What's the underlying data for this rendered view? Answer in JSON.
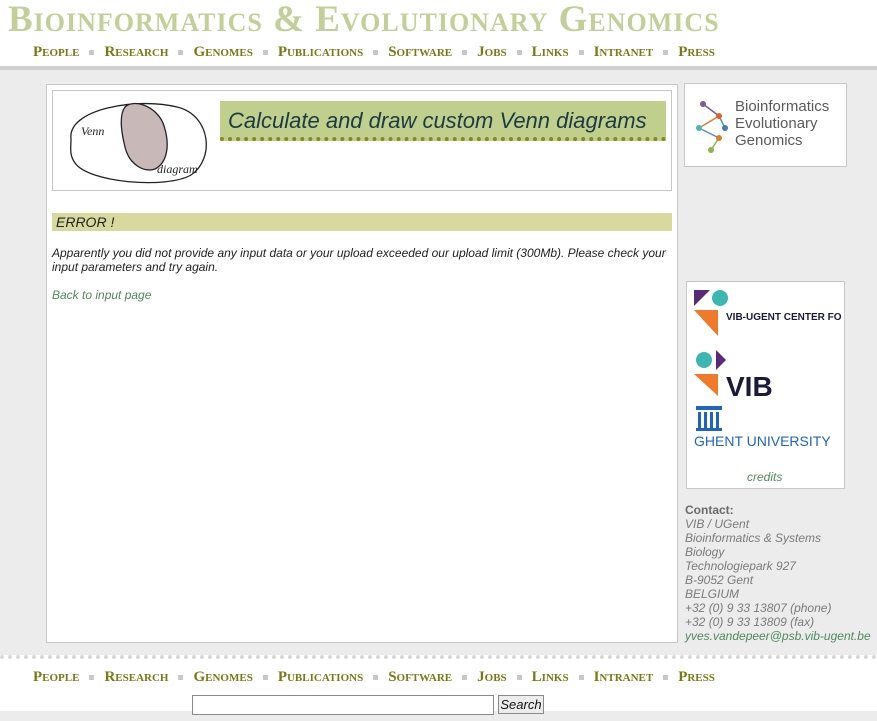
{
  "site": {
    "title": "Bioinformatics & Evolutionary Genomics"
  },
  "nav": {
    "items": [
      "People",
      "Research",
      "Genomes",
      "Publications",
      "Software",
      "Jobs",
      "Links",
      "Intranet",
      "Press"
    ]
  },
  "banner": {
    "title": "Calculate and draw custom Venn diagrams",
    "logo_words": [
      "Venn",
      "diagram"
    ]
  },
  "error": {
    "heading": "ERROR !",
    "message": "Apparently you did not provide any input data or your upload exceeded our upload limit (300Mb). Please check your input parameters and try again.",
    "back_link": "Back to input page"
  },
  "sidebar": {
    "beg_logo_lines": [
      "Bioinformatics",
      "Evolutionary",
      "Genomics"
    ],
    "partners": [
      "VIB-UGENT CENTER FOR PLANT SYSTEMS BIOLOGY",
      "VIB",
      "GHENT UNIVERSITY"
    ],
    "credits_link": "credits",
    "contact": {
      "label": "Contact:",
      "lines": [
        "VIB / UGent",
        "Bioinformatics & Systems",
        "Biology",
        "Technologiepark 927",
        "B-9052 Gent",
        "BELGIUM",
        "+32 (0) 9 33 13807 (phone)",
        "+32 (0) 9 33 13809 (fax)"
      ],
      "email": "yves.vandepeer@psb.vib-ugent.be"
    }
  },
  "footer": {
    "search_button": "Search",
    "search_value": ""
  },
  "colors": {
    "title": "#c2cf96",
    "nav": "#7a7a14",
    "banner_bg": "#c0cf8c",
    "error_bg": "#d8d99c",
    "link": "#4c8a5a"
  }
}
